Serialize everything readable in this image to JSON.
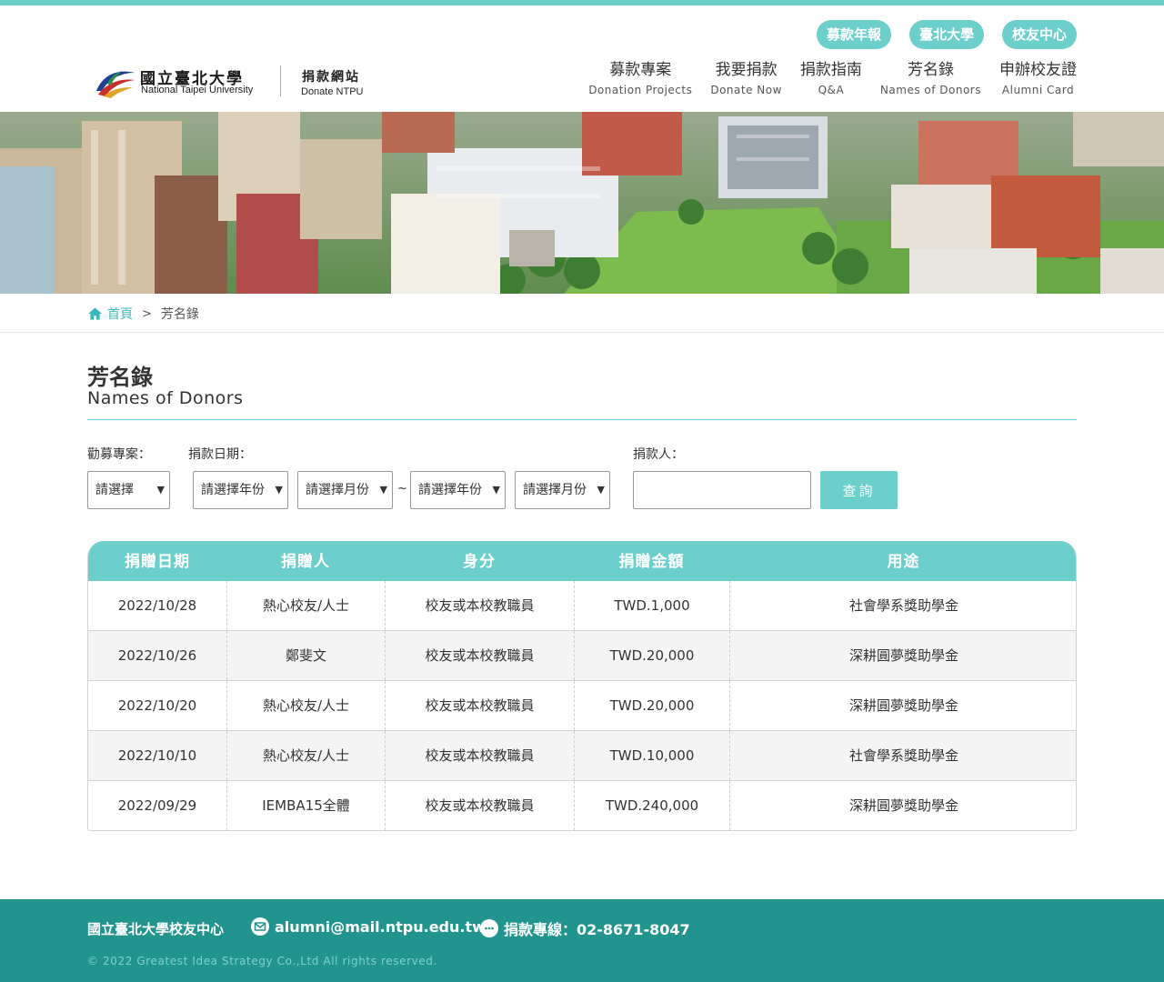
{
  "header": {
    "pills": [
      "募款年報",
      "臺北大學",
      "校友中心"
    ],
    "logo": {
      "name_cn": "國立臺北大學",
      "name_en": "National Taipei University",
      "site_cn": "捐款網站",
      "site_en": "Donate NTPU"
    },
    "nav": [
      {
        "cn": "募款專案",
        "en": "Donation Projects"
      },
      {
        "cn": "我要捐款",
        "en": "Donate Now"
      },
      {
        "cn": "捐款指南",
        "en": "Q&A"
      },
      {
        "cn": "芳名錄",
        "en": "Names of Donors"
      },
      {
        "cn": "申辦校友證",
        "en": "Alumni Card"
      }
    ]
  },
  "breadcrumb": {
    "home": "首頁",
    "separator": ">",
    "current": "芳名錄"
  },
  "page": {
    "title_cn": "芳名錄",
    "title_en": "Names of Donors"
  },
  "filters": {
    "project_label": "勸募專案：",
    "date_label": "捐款日期：",
    "donor_label": "捐款人：",
    "project_select": "請選擇",
    "start_year": "請選擇年份",
    "start_month": "請選擇月份",
    "range_sep": "~",
    "end_year": "請選擇年份",
    "end_month": "請選擇月份",
    "donor_value": "",
    "query_button": "查詢"
  },
  "table": {
    "columns": [
      "捐贈日期",
      "捐贈人",
      "身分",
      "捐贈金額",
      "用途"
    ],
    "rows": [
      [
        "2022/10/28",
        "熱心校友/人士",
        "校友或本校教職員",
        "TWD.1,000",
        "社會學系獎助學金"
      ],
      [
        "2022/10/26",
        "鄭斐文",
        "校友或本校教職員",
        "TWD.20,000",
        "深耕圓夢獎助學金"
      ],
      [
        "2022/10/20",
        "熱心校友/人士",
        "校友或本校教職員",
        "TWD.20,000",
        "深耕圓夢獎助學金"
      ],
      [
        "2022/10/10",
        "熱心校友/人士",
        "校友或本校教職員",
        "TWD.10,000",
        "社會學系獎助學金"
      ],
      [
        "2022/09/29",
        "IEMBA15全體",
        "校友或本校教職員",
        "TWD.240,000",
        "深耕圓夢獎助學金"
      ]
    ]
  },
  "footer": {
    "org": "國立臺北大學校友中心",
    "email": "alumni@mail.ntpu.edu.tw",
    "phone": "捐款專線：02-8671-8047",
    "copyright": "© 2022 Greatest Idea Strategy Co.,Ltd All rights reserved."
  },
  "colors": {
    "accent": "#6ccfcc",
    "footer": "#22948e",
    "link": "#3db7bf"
  }
}
